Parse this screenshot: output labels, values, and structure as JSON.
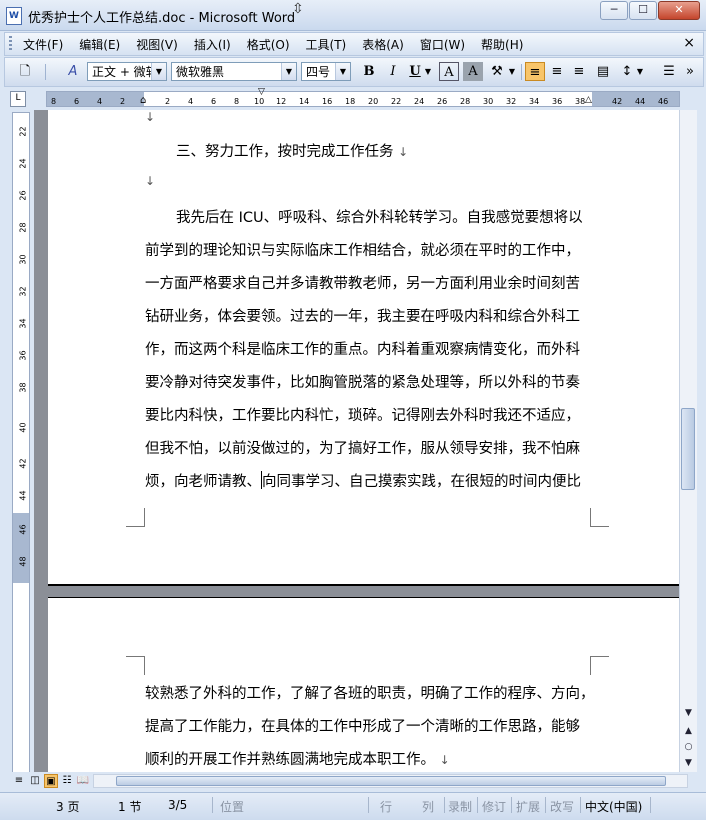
{
  "window": {
    "title": "优秀护士个人工作总结.doc - Microsoft Word",
    "app_icon": "W",
    "minimize": "─",
    "maximize": "☐",
    "close": "✕"
  },
  "menu": {
    "items": [
      "文件(F)",
      "编辑(E)",
      "视图(V)",
      "插入(I)",
      "格式(O)",
      "工具(T)",
      "表格(A)",
      "窗口(W)",
      "帮助(H)"
    ],
    "close": "×"
  },
  "toolbar": {
    "style": "正文 + 微软",
    "font": "微软雅黑",
    "size": "四号",
    "bold": "B",
    "italic": "I",
    "underline": "U",
    "char_border": "A",
    "char_shade": "A",
    "highlight": "A"
  },
  "ruler": {
    "corner": "L",
    "numbers": [
      "8",
      "6",
      "4",
      "2",
      "2",
      "4",
      "6",
      "8",
      "10",
      "12",
      "14",
      "16",
      "18",
      "20",
      "22",
      "24",
      "26",
      "28",
      "30",
      "32",
      "34",
      "36",
      "38",
      "42",
      "44",
      "46"
    ]
  },
  "vruler": {
    "numbers": [
      "22",
      "24",
      "26",
      "28",
      "30",
      "32",
      "34",
      "36",
      "38",
      "40",
      "42",
      "44",
      "46",
      "48"
    ]
  },
  "document": {
    "heading": "三、努力工作，按时完成工作任务",
    "para_mark": "↓",
    "lines": [
      "我先后在 ICU、呼吸科、综合外科轮转学习。自我感觉要想将以",
      "前学到的理论知识与实际临床工作相结合，就必须在平时的工作中，",
      "一方面严格要求自己并多请教带教老师，另一方面利用业余时间刻苦",
      "钻研业务，体会要领。过去的一年，我主要在呼吸内科和综合外科工",
      "作，而这两个科是临床工作的重点。内科着重观察病情变化，而外科",
      "要冷静对待突发事件，比如胸管脱落的紧急处理等，所以外科的节奏",
      "要比内科快，工作要比内科忙，琐碎。记得刚去外科时我还不适应，",
      "但我不怕，以前没做过的，为了搞好工作，服从领导安排，我不怕麻"
    ],
    "line9_before": "烦，向老师请教、",
    "line9_after": "向同事学习、自己摸索实践，在很短的时间内便比",
    "page2_lines": [
      "较熟悉了外科的工作，了解了各班的职责，明确了工作的程序、方向，",
      "提高了工作能力，在具体的工作中形成了一个清晰的工作思路，能够"
    ],
    "page2_last": "顺利的开展工作并熟练圆满地完成本职工作。"
  },
  "status": {
    "page": "3 页",
    "section": "1 节",
    "pages": "3/5",
    "position": "位置",
    "line": "行",
    "column": "列",
    "record": "录制",
    "revise": "修订",
    "extend": "扩展",
    "overwrite": "改写",
    "language": "中文(中国)"
  }
}
